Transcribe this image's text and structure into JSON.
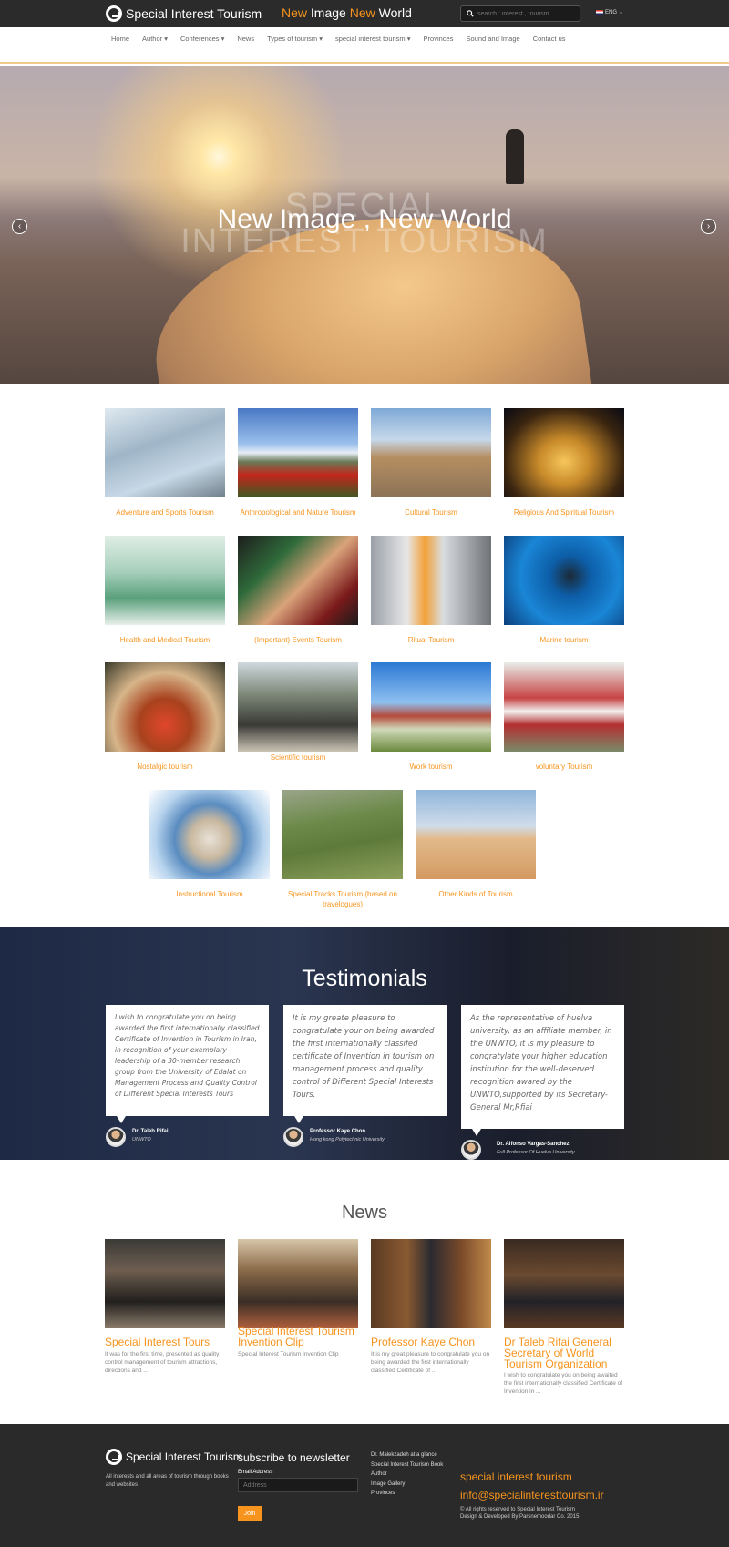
{
  "header": {
    "brand": "Special Interest Tourism",
    "tagline": {
      "w1": "New",
      "w2": "Image",
      "w3": "New",
      "w4": "World"
    },
    "search_placeholder": "search : interest , tourism",
    "language": "ENG"
  },
  "nav": {
    "items": [
      "Home",
      "Author ▾",
      "Conferences ▾",
      "News",
      "Types of tourism ▾",
      "special interest tourism ▾",
      "Provinces",
      "Sound and Image",
      "Contact us"
    ]
  },
  "hero": {
    "title": "New Image , New World",
    "bg_line1": "SPECIAL",
    "bg_line2": "INTEREST TOURISM",
    "prev_icon": "‹",
    "next_icon": "›"
  },
  "tourism_types": [
    {
      "label": "Adventure and Sports Tourism"
    },
    {
      "label": "Anthropological and Nature Tourism"
    },
    {
      "label": "Cultural Tourism"
    },
    {
      "label": "Religious And Spiritual Tourism"
    },
    {
      "label": "Health and Medical Tourism"
    },
    {
      "label": "(Important) Events Tourism"
    },
    {
      "label": "Ritual Tourism"
    },
    {
      "label": "Marine tourism"
    },
    {
      "label": "Nostalgic tourism"
    },
    {
      "label": "Scientific tourism"
    },
    {
      "label": "Work tourism"
    },
    {
      "label": "voluntary Tourism"
    },
    {
      "label": "Instructional Tourism"
    },
    {
      "label": "Special Tracks Tourism (based on travelogues)"
    },
    {
      "label": "Other Kinds of Tourism"
    }
  ],
  "testimonials": {
    "title": "Testimonials",
    "items": [
      {
        "text": "I wish to congratulate you on being awarded the first internationally classified Certificate of Invention in Tourism in Iran, in recognition of your exemplary leadership of a 30-member research group from the University of Edalat on Management Process and Quality Control of Different Special Interests Tours",
        "name": "Dr. Taleb Rifai",
        "role": "UNWTO"
      },
      {
        "text": "It is my greate pleasure to congratulate your on being awarded the first internationally classifed certificate of Invention in tourism on management process and quality control of Different Special Interests Tours.",
        "name": "Professor Kaye Chon",
        "role": "Hong kong Polytechnic University"
      },
      {
        "text": "As the representative of huelva university, as an affiliate member, in the UNWTO, it is my pleasure to congratylate your higher education institution for the well-deserved recognition awared by the UNWTO,supported by its Secretary-General Mr,Rfiai",
        "name": "Dr. Alfonso Vargas-Sanchez",
        "role": "Full Professor Of Huelva University"
      }
    ]
  },
  "news": {
    "title": "News",
    "items": [
      {
        "title": "Special Interest Tours",
        "text": "It was for the first time, presented as quality control management of tourism attractions, directions and ..."
      },
      {
        "title": "Special Interest Tourism Invention Clip",
        "text": "Special Interest Tourism Invention Clip"
      },
      {
        "title": "Professor Kaye Chon",
        "text": "It is my great pleasure to congratulate you on being awarded the first internationally classified Certificate of ..."
      },
      {
        "title": "Dr Taleb Rifai General Secretary of World Tourism Organization",
        "text": "I wish to congratulate you on being awaited the first internationally classified Certificate of Invention in ..."
      }
    ]
  },
  "footer": {
    "brand": "Special Interest Tourism",
    "about": "All interests and all areas of tourism through books and websites",
    "newsletter_title": "subscribe to newsletter",
    "email_label": "Email Address",
    "email_placeholder": "Address",
    "join_label": "Join",
    "links": [
      "Dr. Malekzadeh at a glance",
      "Special Interest Tourism Book",
      "Author",
      "Image Gallery",
      "Provinces"
    ],
    "site_name": "special interest tourism",
    "email": "info@specialinteresttourism.ir",
    "copyright": "© All rights reserved to Special Interest Tourism",
    "credit": "Design & Developed By Parsnemoodar Co. 2015"
  },
  "colors": {
    "accent": "#f7941e",
    "topbar": "#2b2b2b",
    "footer": "#2a2a2a"
  }
}
